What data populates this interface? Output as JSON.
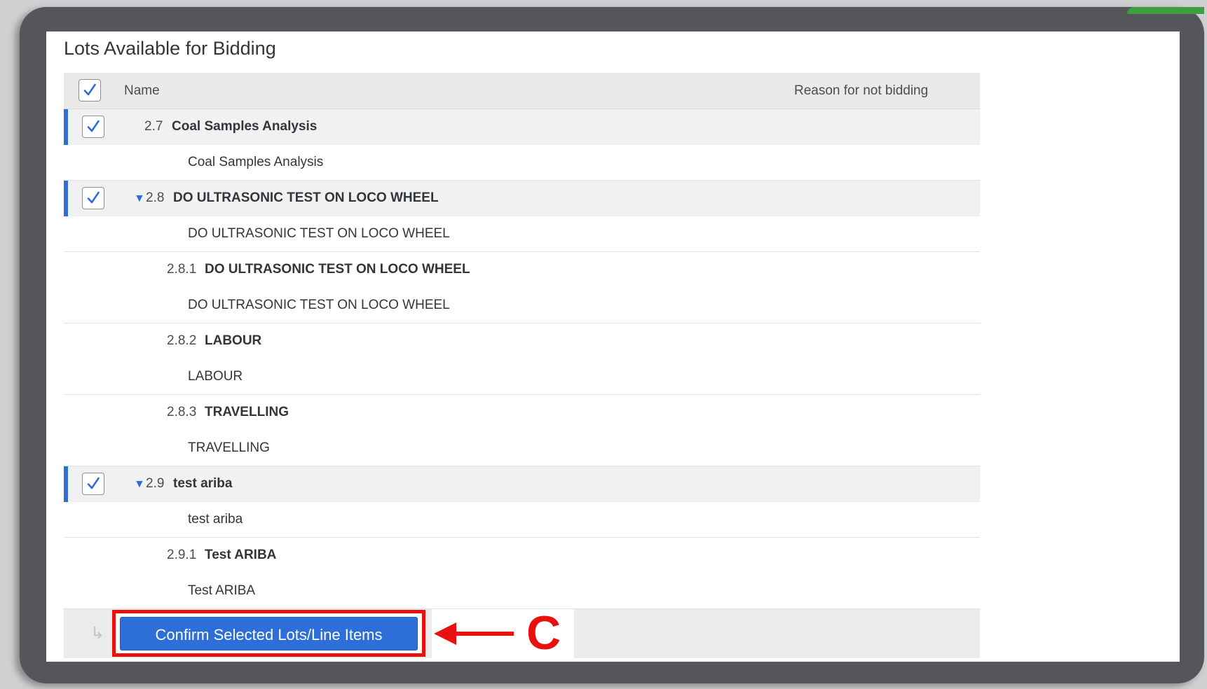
{
  "page": {
    "title": "Lots Available for Bidding"
  },
  "table": {
    "columns": {
      "name": "Name",
      "reason": "Reason for not bidding"
    },
    "rows": [
      {
        "kind": "lot",
        "checked": true,
        "expandable": false,
        "number": "2.7",
        "label": "Coal Samples Analysis"
      },
      {
        "kind": "desc",
        "text": "Coal Samples Analysis"
      },
      {
        "kind": "lot",
        "checked": true,
        "expandable": true,
        "number": "2.8",
        "label": "DO ULTRASONIC TEST ON LOCO WHEEL"
      },
      {
        "kind": "desc",
        "text": "DO ULTRASONIC TEST ON LOCO WHEEL"
      },
      {
        "kind": "sub",
        "number": "2.8.1",
        "label": "DO ULTRASONIC TEST ON LOCO WHEEL"
      },
      {
        "kind": "desc",
        "text": "DO ULTRASONIC TEST ON LOCO WHEEL"
      },
      {
        "kind": "sub",
        "number": "2.8.2",
        "label": "LABOUR"
      },
      {
        "kind": "desc",
        "text": "LABOUR"
      },
      {
        "kind": "sub",
        "number": "2.8.3",
        "label": "TRAVELLING"
      },
      {
        "kind": "desc",
        "text": "TRAVELLING"
      },
      {
        "kind": "lot",
        "checked": true,
        "expandable": true,
        "number": "2.9",
        "label": "test ariba"
      },
      {
        "kind": "desc",
        "text": "test ariba"
      },
      {
        "kind": "sub",
        "number": "2.9.1",
        "label": "Test ARIBA"
      },
      {
        "kind": "desc",
        "text": "Test ARIBA"
      }
    ]
  },
  "footer": {
    "confirm_label": "Confirm Selected Lots/Line Items",
    "callout_letter": "C"
  },
  "icons": {
    "checkbox": "check-icon",
    "expand": "triangle-down-icon",
    "return": "return-arrow-icon",
    "annotation": "left-arrow-icon"
  },
  "colors": {
    "accent": "#2f6ed1",
    "button": "#2e6ed8",
    "annotation": "#e8110f"
  }
}
